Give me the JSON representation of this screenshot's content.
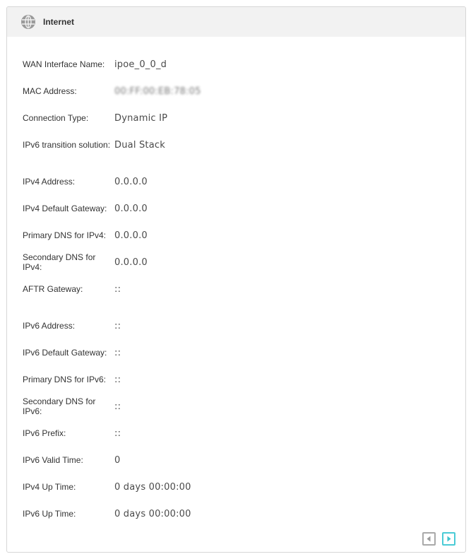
{
  "panel": {
    "title": "Internet",
    "icon": "globe-icon"
  },
  "rows": [
    {
      "label": "WAN Interface Name:",
      "value": "ipoe_0_0_d"
    },
    {
      "label": "MAC Address:",
      "value": "00:FF:00:EB:78:05"
    },
    {
      "label": "Connection Type:",
      "value": "Dynamic IP"
    },
    {
      "label": "IPv6 transition solution:",
      "value": "Dual Stack"
    },
    {
      "label": "IPv4 Address:",
      "value": "0.0.0.0"
    },
    {
      "label": "IPv4 Default Gateway:",
      "value": "0.0.0.0"
    },
    {
      "label": "Primary DNS for IPv4:",
      "value": "0.0.0.0"
    },
    {
      "label": "Secondary DNS for IPv4:",
      "value": "0.0.0.0"
    },
    {
      "label": "AFTR Gateway:",
      "value": "::"
    },
    {
      "label": "IPv6 Address:",
      "value": "::"
    },
    {
      "label": "IPv6 Default Gateway:",
      "value": "::"
    },
    {
      "label": "Primary DNS for IPv6:",
      "value": "::"
    },
    {
      "label": "Secondary DNS for IPv6:",
      "value": "::"
    },
    {
      "label": "IPv6 Prefix:",
      "value": "::"
    },
    {
      "label": "IPv6 Valid Time:",
      "value": "0"
    },
    {
      "label": "IPv4 Up Time:",
      "value": "0 days 00:00:00"
    },
    {
      "label": "IPv6 Up Time:",
      "value": "0 days 00:00:00"
    }
  ],
  "pagination": {
    "prev_icon": "chevron-left-icon",
    "next_icon": "chevron-right-icon",
    "next_active_color": "#4acbd6",
    "prev_color": "#a9a9a9"
  }
}
